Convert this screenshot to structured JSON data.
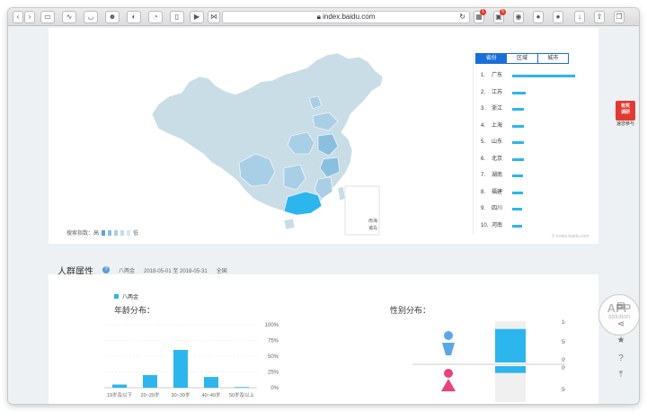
{
  "browser": {
    "url": "index.baidu.com",
    "nav": {
      "back_icon": "chevron-left-icon",
      "forward_icon": "chevron-right-icon"
    },
    "badges": [
      "1",
      "5"
    ]
  },
  "map": {
    "legend_label": "搜索指数：高",
    "legend_low": "低",
    "legend_colors": [
      "#5aa3d6",
      "#8bbfe0",
      "#a9cfe6",
      "#c2dcea",
      "#d6e6ee"
    ],
    "inset_label_1": "南海",
    "inset_label_2": "诸岛",
    "highlight_color": "#2db5ee",
    "base_color": "#c9dde7"
  },
  "ranking": {
    "tabs": [
      {
        "label": "省份",
        "active": true
      },
      {
        "label": "区域",
        "active": false
      },
      {
        "label": "城市",
        "active": false
      }
    ],
    "items": [
      {
        "rank": "1.",
        "name": "广东",
        "value": 100
      },
      {
        "rank": "2.",
        "name": "江苏",
        "value": 21
      },
      {
        "rank": "3.",
        "name": "浙江",
        "value": 19
      },
      {
        "rank": "4.",
        "name": "上海",
        "value": 19
      },
      {
        "rank": "5.",
        "name": "山东",
        "value": 18
      },
      {
        "rank": "6.",
        "name": "北京",
        "value": 18
      },
      {
        "rank": "7.",
        "name": "湖南",
        "value": 17
      },
      {
        "rank": "8.",
        "name": "福建",
        "value": 17
      },
      {
        "rank": "9.",
        "name": "四川",
        "value": 16
      },
      {
        "rank": "10.",
        "name": "河南",
        "value": 16
      }
    ],
    "watermark": "© index.baidu.com"
  },
  "section": {
    "title": "人群属性",
    "help_icon": "question-icon",
    "keyword": "八两金",
    "date_range": "2018-05-01 至 2018-05-31",
    "region": "全国"
  },
  "demographics": {
    "legend": "八两金",
    "age_title": "年龄分布：",
    "gender_title": "性别分布："
  },
  "chart_data": [
    {
      "type": "bar",
      "title": "年龄分布：",
      "categories": [
        "19岁及以下",
        "20~29岁",
        "30~39岁",
        "40~49岁",
        "50岁及以上"
      ],
      "values": [
        5,
        20,
        60,
        17,
        1
      ],
      "ylim": [
        0,
        100
      ],
      "y_ticks": [
        "100%",
        "75%",
        "50%",
        "25%",
        "0%"
      ],
      "color": "#2db5ee"
    },
    {
      "type": "bar",
      "title": "性别分布：",
      "categories": [
        "male",
        "female"
      ],
      "values": [
        81,
        19
      ],
      "ylim": [
        0,
        100
      ],
      "y_ticks_top": [
        "100%",
        "50%",
        "0%"
      ],
      "y_ticks_bottom": [
        "0%",
        "50%"
      ],
      "colors": {
        "male": "#2db5ee",
        "female": "#2db5ee",
        "male_icon": "#5aa7e8",
        "female_icon": "#e8447a"
      }
    }
  ],
  "floating": {
    "ad_line1": "有奖",
    "ad_line2": "调研",
    "ad_caption": "速您参与",
    "watermark_1": "APP",
    "watermark_2": "solution"
  }
}
